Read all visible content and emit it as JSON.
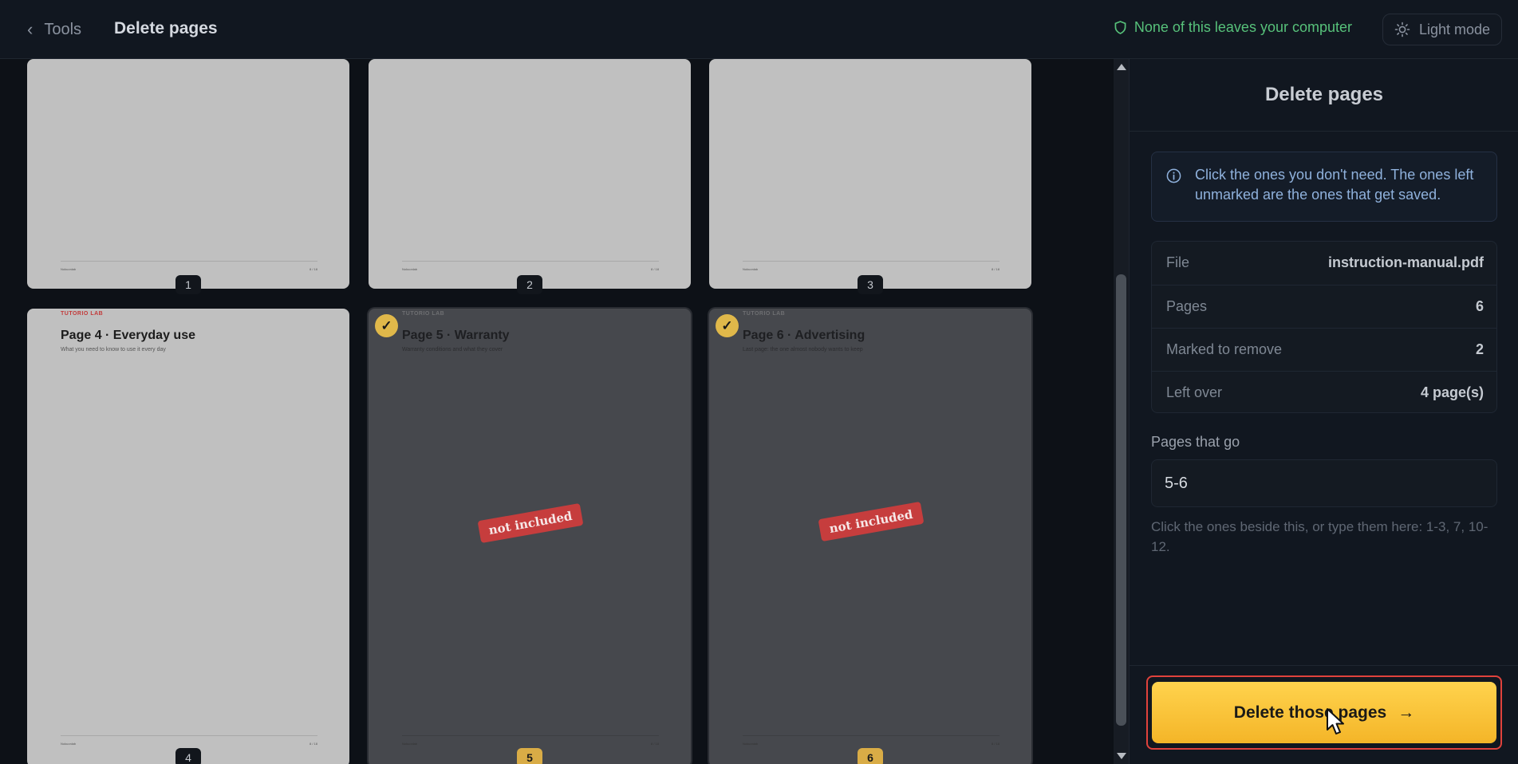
{
  "header": {
    "back_label": "Tools",
    "title": "Delete pages",
    "privacy_note": "None of this leaves your computer",
    "theme_toggle": "Light mode"
  },
  "pages": [
    {
      "number": "1",
      "marked": false,
      "brand": "",
      "title": "",
      "subtitle": "",
      "footer_left": "Nokuonlab",
      "footer_right": "8 / 18"
    },
    {
      "number": "2",
      "marked": false,
      "brand": "",
      "title": "",
      "subtitle": "",
      "footer_left": "Nokuonlab",
      "footer_right": "8 / 18"
    },
    {
      "number": "3",
      "marked": false,
      "brand": "",
      "title": "",
      "subtitle": "",
      "footer_left": "Nokuonlab",
      "footer_right": "8 / 18"
    },
    {
      "number": "4",
      "marked": false,
      "brand": "TUTORIO LAB",
      "title": "Page 4 · Everyday use",
      "subtitle": "What you need to know to use it every day",
      "footer_left": "Nokuonlab",
      "footer_right": "8 / 18"
    },
    {
      "number": "5",
      "marked": true,
      "brand": "TUTORIO LAB",
      "title": "Page 5 · Warranty",
      "subtitle": "Warranty conditions and what they cover",
      "footer_left": "Nokuonlab",
      "footer_right": "8 / 18",
      "stamp": "not included"
    },
    {
      "number": "6",
      "marked": true,
      "brand": "TUTORIO LAB",
      "title": "Page 6 · Advertising",
      "subtitle": "Last page: the one almost nobody wants to keep",
      "footer_left": "Nokuonlab",
      "footer_right": "8 / 18",
      "stamp": "not included"
    }
  ],
  "sidebar": {
    "title": "Delete pages",
    "info": "Click the ones you don't need. The ones left unmarked are the ones that get saved.",
    "stats": [
      {
        "label": "File",
        "value": "instruction-manual.pdf"
      },
      {
        "label": "Pages",
        "value": "6"
      },
      {
        "label": "Marked to remove",
        "value": "2"
      },
      {
        "label": "Left over",
        "value": "4 page(s)"
      }
    ],
    "pages_field_label": "Pages that go",
    "pages_field_value": "5-6",
    "hint": "Click the ones beside this, or type them here: 1-3, 7, 10-12.",
    "cta_label": "Delete those pages",
    "cta_arrow": "→"
  },
  "icons": {
    "back": "chevron-left-icon",
    "privacy": "shield-icon",
    "theme": "sun-icon",
    "info": "info-icon",
    "check": "check-icon",
    "cta": "arrow-right-icon"
  },
  "colors": {
    "accent": "#f4b528",
    "privacy_green": "#57c17a",
    "stamp_red": "#c63d3d",
    "highlight_border": "#e0423c"
  }
}
